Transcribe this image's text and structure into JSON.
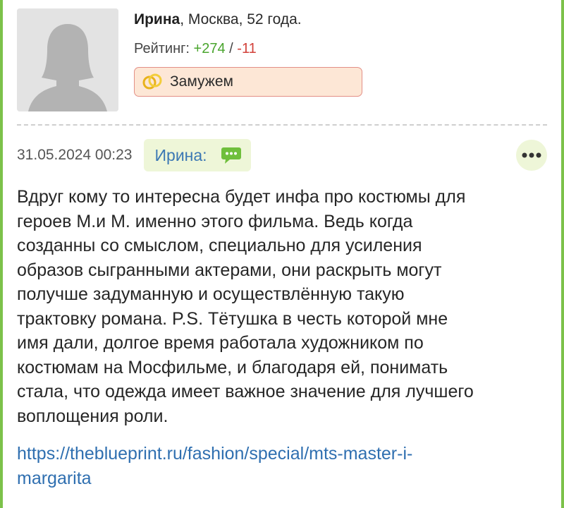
{
  "user": {
    "name": "Ирина",
    "location_age": ", Москва, 52 года.",
    "rating_label": "Рейтинг:",
    "rating_plus": "+274",
    "rating_separator": "/",
    "rating_minus": "-11",
    "status": "Замужем",
    "avatar_icon": "female-silhouette-icon",
    "status_icon": "wedding-rings-icon"
  },
  "post": {
    "date": "31.05.2024 00:23",
    "author": "Ирина:",
    "author_icon": "chat-bubble-icon",
    "more_icon": "ellipsis-icon",
    "body_lines": [
      "Вдруг кому то интересна будет инфа про костюмы для",
      "героев М.и М. именно этого фильма. Ведь когда",
      "созданны со смыслом, специально для усиления",
      "образов сыгранными актерами, они раскрыть могут",
      "получше задуманную и осуществлённую такую",
      "трактовку романа. P.S. Тётушка в честь которой мне",
      "имя дали, долгое время работала художником по",
      "костюмам на Мосфильме, и благодаря ей, понимать",
      "стала, что одежда имеет важное значение для лучшего",
      "воплощения роли."
    ],
    "link_lines": [
      "https://theblueprint.ru/fashion/special/mts-master-i-",
      "margarita"
    ]
  },
  "colors": {
    "frame_green": "#7cc24a",
    "rating_plus": "#4aa52e",
    "rating_minus": "#d2413a",
    "link": "#2f6fb0",
    "author": "#3c78b4",
    "author_tag_bg": "#eef6d8",
    "status_bg": "#fde7d6",
    "status_border": "#e38f86"
  }
}
